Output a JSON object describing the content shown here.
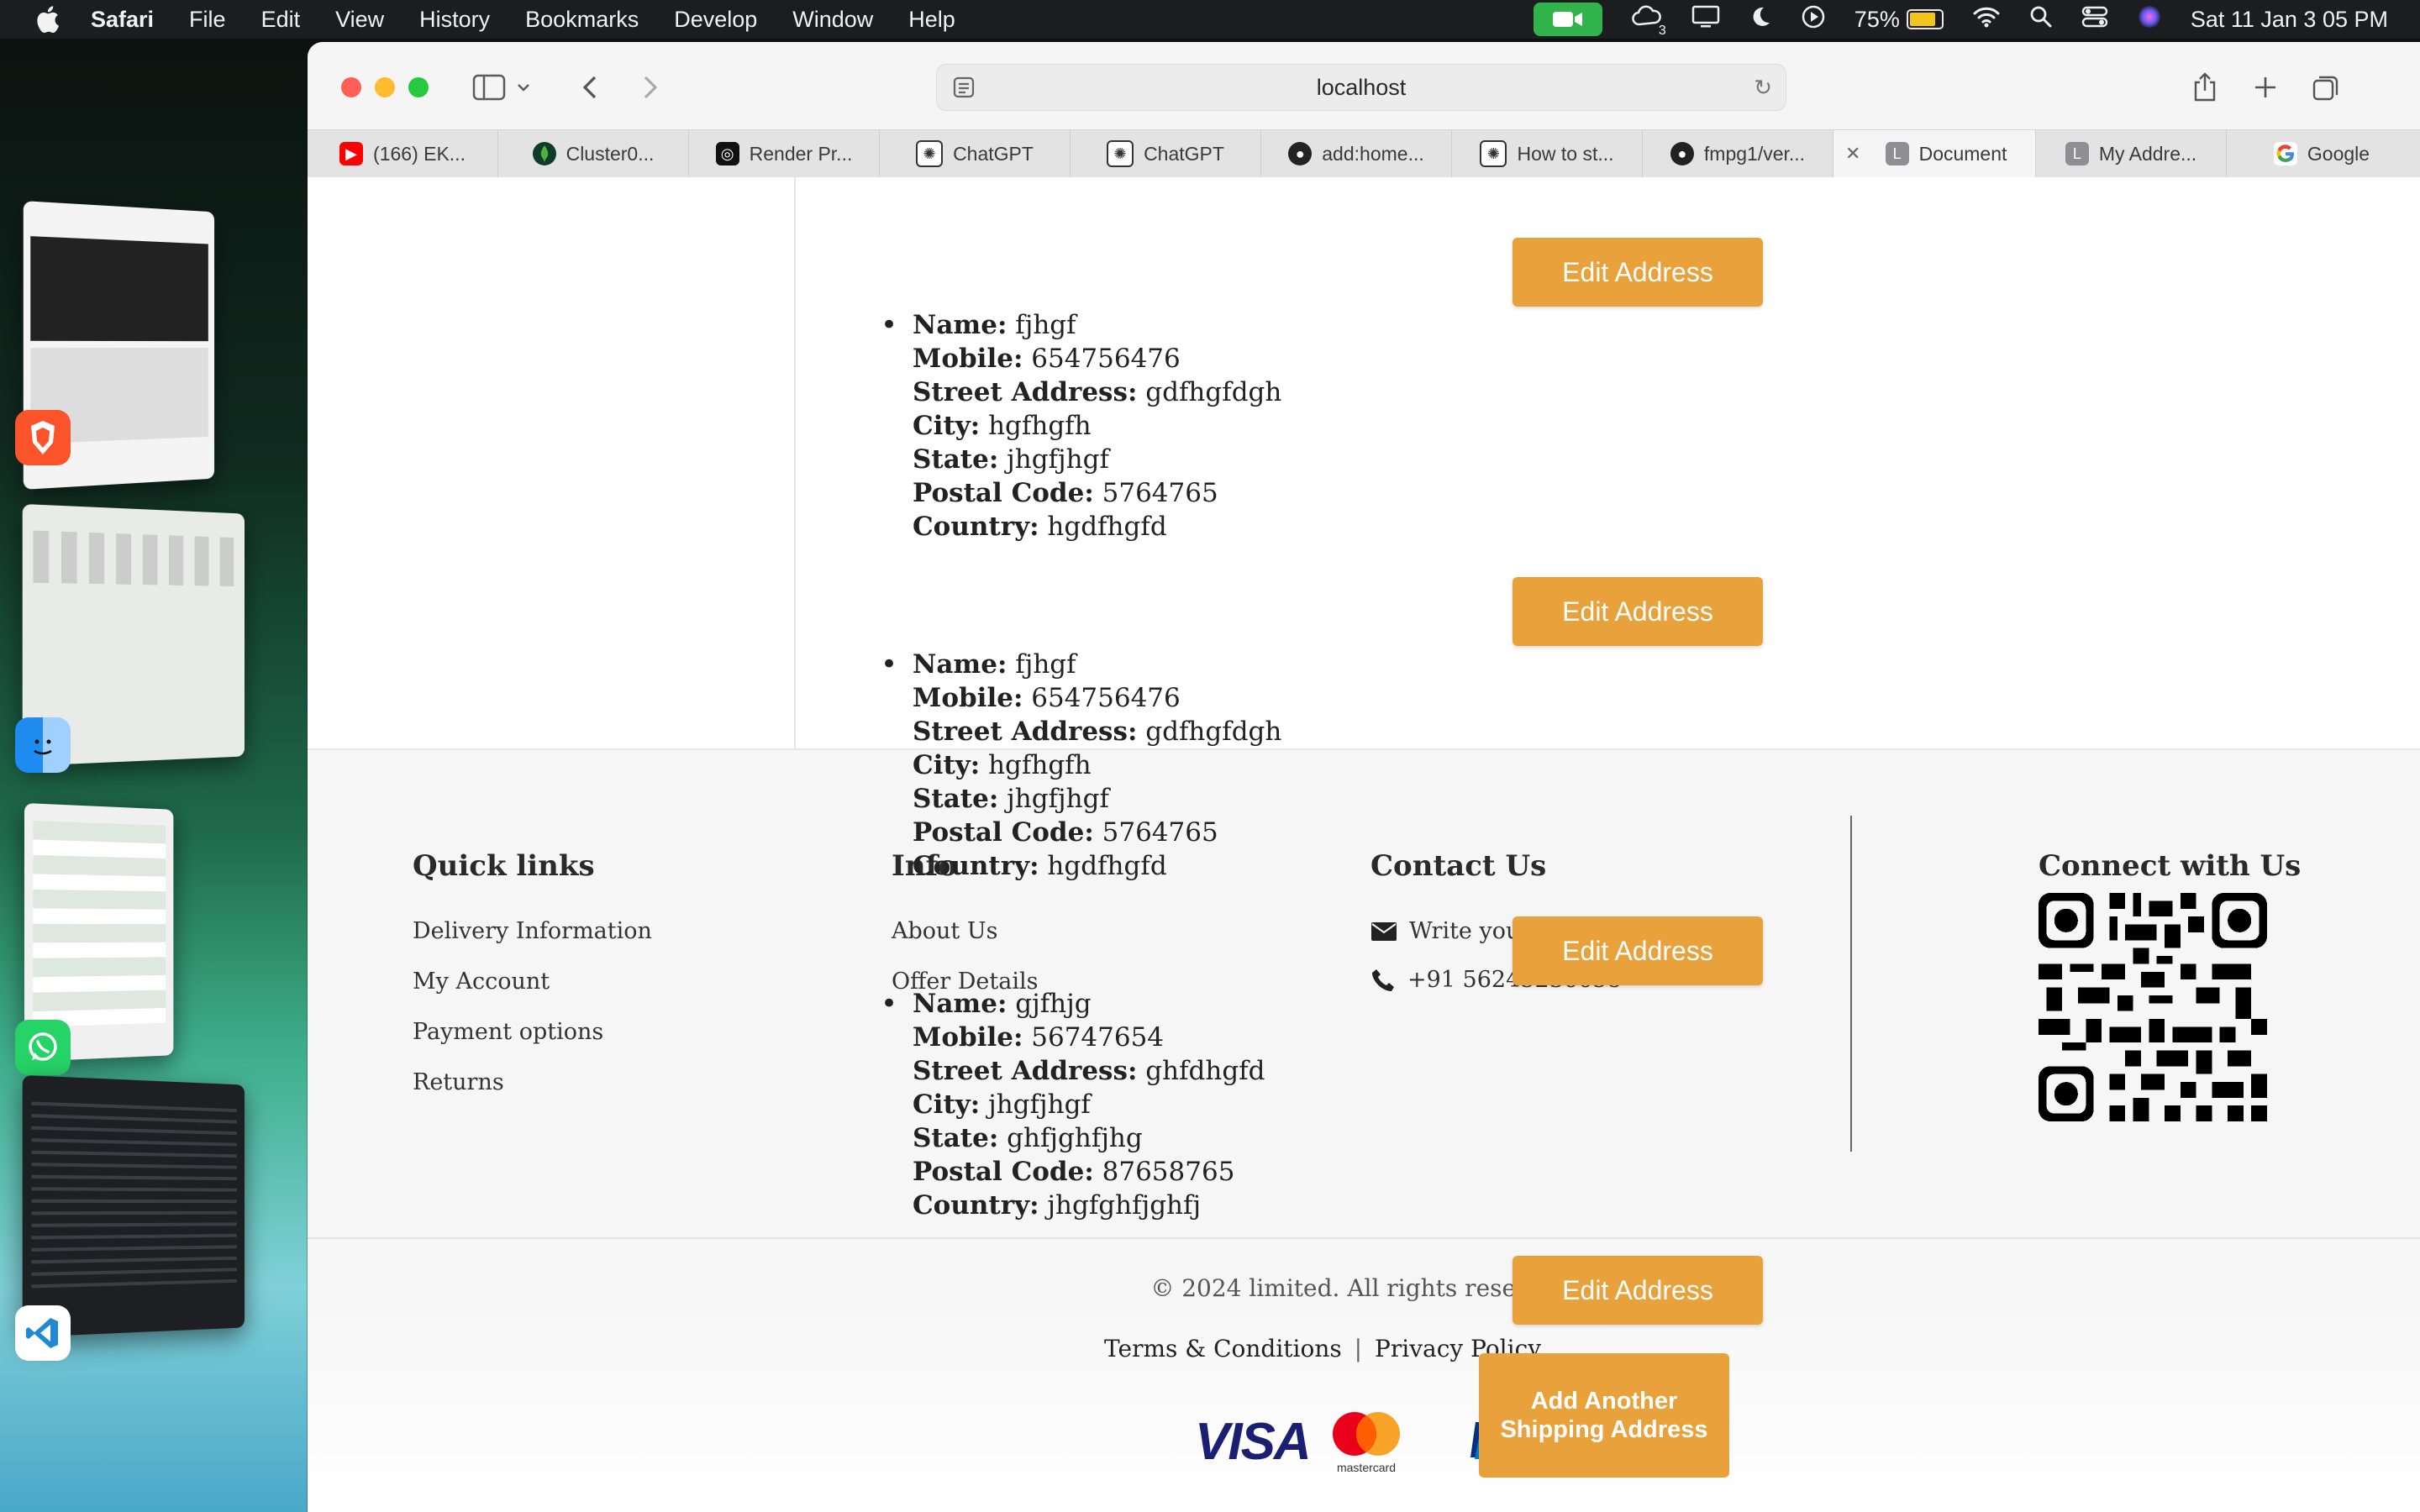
{
  "menubar": {
    "app_name": "Safari",
    "items": [
      "File",
      "Edit",
      "View",
      "History",
      "Bookmarks",
      "Develop",
      "Window",
      "Help"
    ],
    "battery": "75%",
    "notification_count": "3",
    "datetime": "Sat 11 Jan  3 05 PM"
  },
  "browser": {
    "url": "localhost",
    "tabs": [
      {
        "label": "(166) EK...",
        "favicon": "youtube-icon"
      },
      {
        "label": "Cluster0...",
        "favicon": "mongodb-icon"
      },
      {
        "label": "Render Pr...",
        "favicon": "render-icon"
      },
      {
        "label": "ChatGPT",
        "favicon": "chatgpt-icon"
      },
      {
        "label": "ChatGPT",
        "favicon": "chatgpt-icon"
      },
      {
        "label": "add:home...",
        "favicon": "github-icon"
      },
      {
        "label": "How to st...",
        "favicon": "chatgpt-icon"
      },
      {
        "label": "fmpg1/ver...",
        "favicon": "github-icon"
      },
      {
        "label": "Document",
        "favicon": "letter-l-icon",
        "active": true
      },
      {
        "label": "My Addre...",
        "favicon": "letter-l-icon"
      },
      {
        "label": "Google",
        "favicon": "google-icon"
      }
    ],
    "favicon_letter": "L"
  },
  "addresses": {
    "labels": {
      "name": "Name:",
      "mobile": "Mobile:",
      "street": "Street Address:",
      "city": "City:",
      "state": "State:",
      "postal": "Postal Code:",
      "country": "Country:"
    },
    "edit_label": "Edit Address",
    "items": [
      {
        "name": "fjhgf",
        "mobile": "654756476",
        "street": "gdfhgfdgh",
        "city": "hgfhgfh",
        "state": "jhgfjhgf",
        "postal": "5764765",
        "country": "hgdfhgfd"
      },
      {
        "name": "fjhgf",
        "mobile": "654756476",
        "street": "gdfhgfdgh",
        "city": "hgfhgfh",
        "state": "jhgfjhgf",
        "postal": "5764765",
        "country": "hgdfhgfd"
      },
      {
        "name": "gjfhjg",
        "mobile": "56747654",
        "street": "ghfdhgfd",
        "city": "jhgfjhgf",
        "state": "ghfjghfjhg",
        "postal": "87658765",
        "country": "jhgfghfjghfj"
      }
    ],
    "add_label": "Add Another Shipping Address"
  },
  "footer": {
    "quick_links": {
      "title": "Quick links",
      "items": [
        "Delivery Information",
        "My Account",
        "Payment options",
        "Returns"
      ]
    },
    "info": {
      "title": "Info",
      "items": [
        "About Us",
        "Offer Details"
      ]
    },
    "contact": {
      "title": "Contact Us",
      "email_text": "Write you",
      "phone": "+91 56245236658"
    },
    "connect": {
      "title": "Connect with Us"
    },
    "copyright": "© 2024 limited. All rights reserved.",
    "terms": "Terms & Conditions",
    "separator": "|",
    "privacy": "Privacy Policy",
    "payment_methods": {
      "visa": "VISA",
      "mastercard": "mastercard"
    }
  },
  "colors": {
    "accent_button": "#e9a23b",
    "menubar_bg": "#1c1d20",
    "facetime_green": "#2fb34a"
  }
}
